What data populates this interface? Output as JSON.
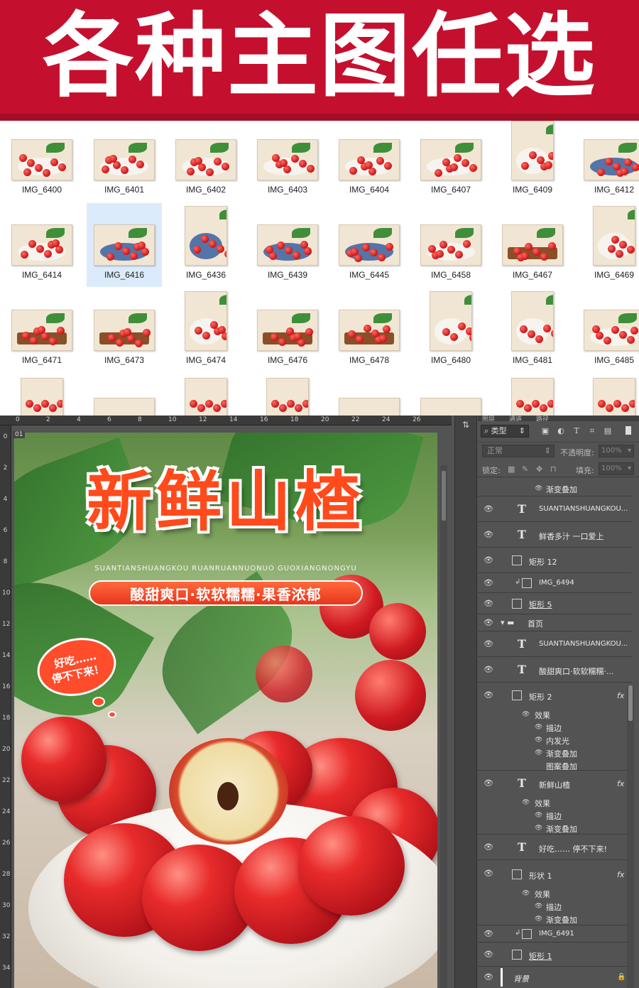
{
  "banner": {
    "title": "各种主图任选"
  },
  "thumbnails": [
    {
      "label": "IMG_6400"
    },
    {
      "label": "IMG_6401"
    },
    {
      "label": "IMG_6402"
    },
    {
      "label": "IMG_6403"
    },
    {
      "label": "IMG_6404"
    },
    {
      "label": "IMG_6407"
    },
    {
      "label": "IMG_6409"
    },
    {
      "label": "IMG_6412"
    },
    {
      "label": "IMG_6414"
    },
    {
      "label": "IMG_6416",
      "selected": true
    },
    {
      "label": "IMG_6436"
    },
    {
      "label": "IMG_6439"
    },
    {
      "label": "IMG_6445"
    },
    {
      "label": "IMG_6458"
    },
    {
      "label": "IMG_6467"
    },
    {
      "label": "IMG_6469"
    },
    {
      "label": "IMG_6471"
    },
    {
      "label": "IMG_6473"
    },
    {
      "label": "IMG_6474"
    },
    {
      "label": "IMG_6476"
    },
    {
      "label": "IMG_6478"
    },
    {
      "label": "IMG_6480"
    },
    {
      "label": "IMG_6481"
    },
    {
      "label": "IMG_6485"
    }
  ],
  "ruler": {
    "top": [
      "0",
      "2",
      "4",
      "6",
      "8",
      "10",
      "12",
      "14",
      "16",
      "18",
      "20",
      "22",
      "24",
      "26"
    ],
    "left": [
      "0",
      "2",
      "4",
      "6",
      "8",
      "10",
      "12",
      "14",
      "16",
      "18",
      "20",
      "22",
      "24",
      "26",
      "28",
      "30",
      "32",
      "34"
    ]
  },
  "document": {
    "tab": "01"
  },
  "artwork": {
    "title": "新鲜山楂",
    "pinyin": "SUANTIANSHUANGKOU RUANRUANNUONUO GUOXIANGNONGYU",
    "tagline": "酸甜爽口·软软糯糯·果香浓郁",
    "bubble_line1": "好吃……",
    "bubble_line2": "停不下来！"
  },
  "panel": {
    "tabs": [
      "图层",
      "通道",
      "路径"
    ],
    "filter": "类型",
    "blend_mode": "正常",
    "opacity_label": "不透明度:",
    "opacity_value": "100%",
    "lock_label": "锁定:",
    "fill_label": "填充:",
    "fill_value": "100%"
  },
  "layers": {
    "gradient_top": "渐变叠加",
    "l1": "SUANTIANSHUANGKOU...",
    "l2": "鲜香多汁 一口爱上",
    "l3": "矩形 12",
    "l4": "IMG_6494",
    "l5": "矩形 5",
    "l6": "首页",
    "l7": "SUANTIANSHUANGKOU...",
    "l8": "酸甜爽口·软软糯糯·...",
    "l9": "矩形 2",
    "l9_effects": "效果",
    "l9_fx1": "描边",
    "l9_fx2": "内发光",
    "l9_fx3": "渐变叠加",
    "l9_fx4": "图案叠加",
    "l10": "新鲜山楂",
    "l10_effects": "效果",
    "l10_fx1": "描边",
    "l10_fx2": "渐变叠加",
    "l11": "好吃…… 停不下来!",
    "l12": "形状 1",
    "l12_effects": "效果",
    "l12_fx1": "描边",
    "l12_fx2": "渐变叠加",
    "l13": "IMG_6491",
    "l14": "矩形 1",
    "l15": "背景",
    "fx_symbol": "fx"
  }
}
